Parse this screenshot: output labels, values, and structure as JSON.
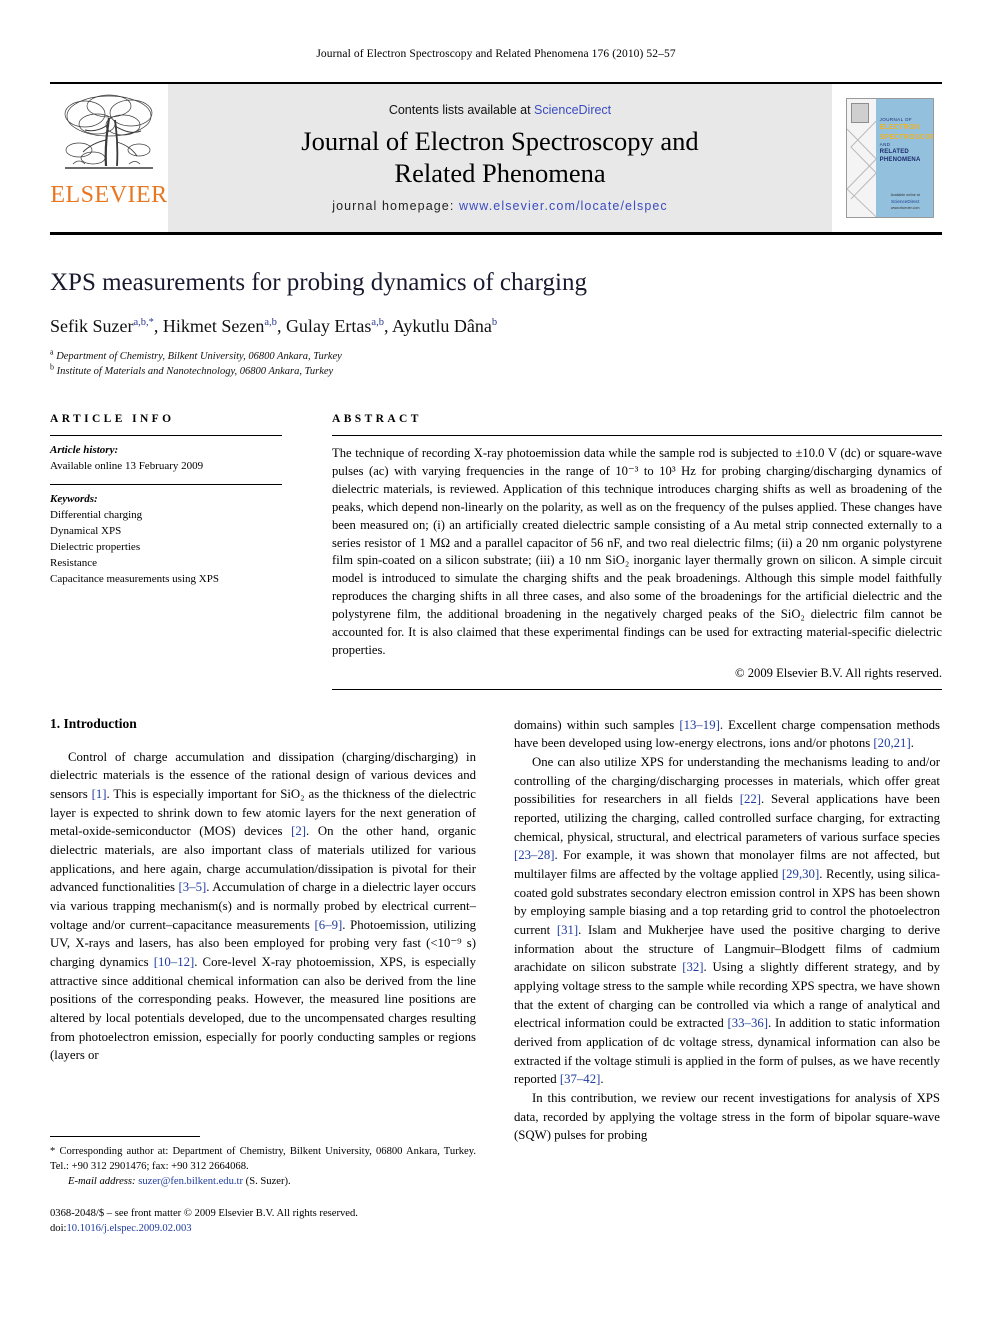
{
  "running_head": "Journal of Electron Spectroscopy and Related Phenomena 176 (2010) 52–57",
  "masthead": {
    "contents_prefix": "Contents lists available at ",
    "sciencedirect": "ScienceDirect",
    "journal_title_line1": "Journal of Electron Spectroscopy and",
    "journal_title_line2": "Related Phenomena",
    "homepage_label": "journal homepage:",
    "homepage_url": "www.elsevier.com/locate/elspec",
    "publisher_wordmark": "ELSEVIER",
    "cover": {
      "line1": "JOURNAL OF",
      "line2": "ELECTRON",
      "line3": "SPECTROSCOPY",
      "line4": "AND",
      "line5": "RELATED PHENOMENA",
      "foot1": "Available online at",
      "foot2": "ScienceDirect",
      "foot3": "www.elsevier.com"
    },
    "accent_link_color": "#3b4cc0",
    "elsevier_orange": "#E87722",
    "panel_gray": "#e8e8e8"
  },
  "title": "XPS measurements for probing dynamics of charging",
  "authors": [
    {
      "name": "Sefik Suzer",
      "sup": "a,b,*"
    },
    {
      "name": "Hikmet Sezen",
      "sup": "a,b"
    },
    {
      "name": "Gulay Ertas",
      "sup": "a,b"
    },
    {
      "name": "Aykutlu Dâna",
      "sup": "b"
    }
  ],
  "affiliations": [
    {
      "marker": "a",
      "text": "Department of Chemistry, Bilkent University, 06800 Ankara, Turkey"
    },
    {
      "marker": "b",
      "text": "Institute of Materials and Nanotechnology, 06800 Ankara, Turkey"
    }
  ],
  "article_info": {
    "heading": "ARTICLE INFO",
    "history_label": "Article history:",
    "history_value": "Available online 13 February 2009",
    "keywords_label": "Keywords:",
    "keywords": [
      "Differential charging",
      "Dynamical XPS",
      "Dielectric properties",
      "Resistance",
      "Capacitance measurements using XPS"
    ]
  },
  "abstract": {
    "heading": "ABSTRACT",
    "text": "The technique of recording X-ray photoemission data while the sample rod is subjected to ±10.0 V (dc) or square-wave pulses (ac) with varying frequencies in the range of 10⁻³ to 10³ Hz for probing charging/discharging dynamics of dielectric materials, is reviewed. Application of this technique introduces charging shifts as well as broadening of the peaks, which depend non-linearly on the polarity, as well as on the frequency of the pulses applied. These changes have been measured on; (i) an artificially created dielectric sample consisting of a Au metal strip connected externally to a series resistor of 1 MΩ and a parallel capacitor of 56 nF, and two real dielectric films; (ii) a 20 nm organic polystyrene film spin-coated on a silicon substrate; (iii) a 10 nm SiO₂ inorganic layer thermally grown on silicon. A simple circuit model is introduced to simulate the charging shifts and the peak broadenings. Although this simple model faithfully reproduces the charging shifts in all three cases, and also some of the broadenings for the artificial dielectric and the polystyrene film, the additional broadening in the negatively charged peaks of the SiO₂ dielectric film cannot be accounted for. It is also claimed that these experimental findings can be used for extracting material-specific dielectric properties.",
    "copyright": "© 2009 Elsevier B.V. All rights reserved."
  },
  "body": {
    "section_heading": "1. Introduction",
    "left_paragraphs": [
      "Control of charge accumulation and dissipation (charging/discharging) in dielectric materials is the essence of the rational design of various devices and sensors [1]. This is especially important for SiO₂ as the thickness of the dielectric layer is expected to shrink down to few atomic layers for the next generation of metal-oxide-semiconductor (MOS) devices [2]. On the other hand, organic dielectric materials, are also important class of materials utilized for various applications, and here again, charge accumulation/dissipation is pivotal for their advanced functionalities [3–5]. Accumulation of charge in a dielectric layer occurs via various trapping mechanism(s) and is normally probed by electrical current–voltage and/or current–capacitance measurements [6–9]. Photoemission, utilizing UV, X-rays and lasers, has also been employed for probing very fast (<10⁻⁹ s) charging dynamics [10–12]. Core-level X-ray photoemission, XPS, is especially attractive since additional chemical information can also be derived from the line positions of the corresponding peaks. However, the measured line positions are altered by local potentials developed, due to the uncompensated charges resulting from photoelectron emission, especially for poorly conducting samples or regions (layers or"
    ],
    "right_paragraphs": [
      "domains) within such samples [13–19]. Excellent charge compensation methods have been developed using low-energy electrons, ions and/or photons [20,21].",
      "One can also utilize XPS for understanding the mechanisms leading to and/or controlling of the charging/discharging processes in materials, which offer great possibilities for researchers in all fields [22]. Several applications have been reported, utilizing the charging, called controlled surface charging, for extracting chemical, physical, structural, and electrical parameters of various surface species [23–28]. For example, it was shown that monolayer films are not affected, but multilayer films are affected by the voltage applied [29,30]. Recently, using silica-coated gold substrates secondary electron emission control in XPS has been shown by employing sample biasing and a top retarding grid to control the photoelectron current [31]. Islam and Mukherjee have used the positive charging to derive information about the structure of Langmuir–Blodgett films of cadmium arachidate on silicon substrate [32]. Using a slightly different strategy, and by applying voltage stress to the sample while recording XPS spectra, we have shown that the extent of charging can be controlled via which a range of analytical and electrical information could be extracted [33–36]. In addition to static information derived from application of dc voltage stress, dynamical information can also be extracted if the voltage stimuli is applied in the form of pulses, as we have recently reported [37–42].",
      "In this contribution, we review our recent investigations for analysis of XPS data, recorded by applying the voltage stress in the form of bipolar square-wave (SQW) pulses for probing"
    ]
  },
  "footnotes": {
    "corresponding": "* Corresponding author at: Department of Chemistry, Bilkent University, 06800 Ankara, Turkey. Tel.: +90 312 2901476; fax: +90 312 2664068.",
    "email_label": "E-mail address:",
    "email": "suzer@fen.bilkent.edu.tr",
    "email_suffix": "(S. Suzer).",
    "issn_line": "0368-2048/$ – see front matter © 2009 Elsevier B.V. All rights reserved.",
    "doi_label": "doi:",
    "doi_value": "10.1016/j.elspec.2009.02.003"
  }
}
